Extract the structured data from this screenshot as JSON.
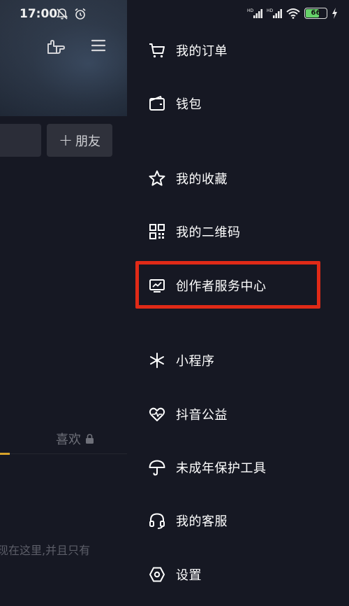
{
  "status_bar": {
    "time": "17:00",
    "battery_level": "66",
    "signal1": "HD",
    "signal2": "HD"
  },
  "profile": {
    "add_friend_label": "朋友",
    "likes_tab_label": "喜欢",
    "hint_text": "现在这里,并且只有"
  },
  "drawer": {
    "items": [
      {
        "label": "我的订单",
        "icon": "cart-icon"
      },
      {
        "label": "钱包",
        "icon": "wallet-icon"
      },
      {
        "label": "我的收藏",
        "icon": "star-icon"
      },
      {
        "label": "我的二维码",
        "icon": "qrcode-icon"
      },
      {
        "label": "创作者服务中心",
        "icon": "creator-chart-icon"
      },
      {
        "label": "小程序",
        "icon": "mini-program-icon"
      },
      {
        "label": "抖音公益",
        "icon": "charity-heart-icon"
      },
      {
        "label": "未成年保护工具",
        "icon": "umbrella-icon"
      },
      {
        "label": "我的客服",
        "icon": "headset-icon"
      },
      {
        "label": "设置",
        "icon": "settings-hexagon-icon"
      }
    ]
  },
  "colors": {
    "highlight": "#e02a17",
    "background": "#161823",
    "tab_indicator": "#d7a22a"
  }
}
